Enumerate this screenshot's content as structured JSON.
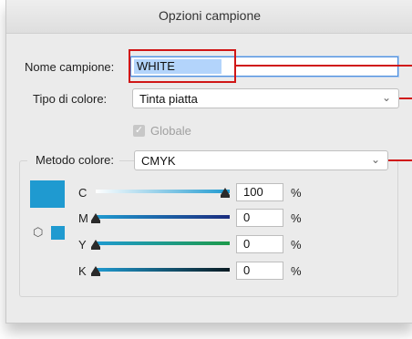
{
  "dialog": {
    "title": "Opzioni campione"
  },
  "name": {
    "label": "Nome campione:",
    "value": "WHITE"
  },
  "color_type": {
    "label": "Tipo di colore:",
    "value": "Tinta piatta"
  },
  "global": {
    "label": "Globale",
    "checked": true,
    "enabled": false
  },
  "color_mode": {
    "label": "Metodo colore:",
    "value": "CMYK"
  },
  "swatch_color": "#1f9ad0",
  "annotation_color": "#d01616",
  "channels": [
    {
      "name": "C",
      "value": "100",
      "unit": "%",
      "level": 1.0
    },
    {
      "name": "M",
      "value": "0",
      "unit": "%",
      "level": 0.0
    },
    {
      "name": "Y",
      "value": "0",
      "unit": "%",
      "level": 0.0
    },
    {
      "name": "K",
      "value": "0",
      "unit": "%",
      "level": 0.0
    }
  ],
  "icons": {
    "chevron": "chevron-down-icon",
    "check": "check-icon",
    "gamut": "cube-icon"
  }
}
